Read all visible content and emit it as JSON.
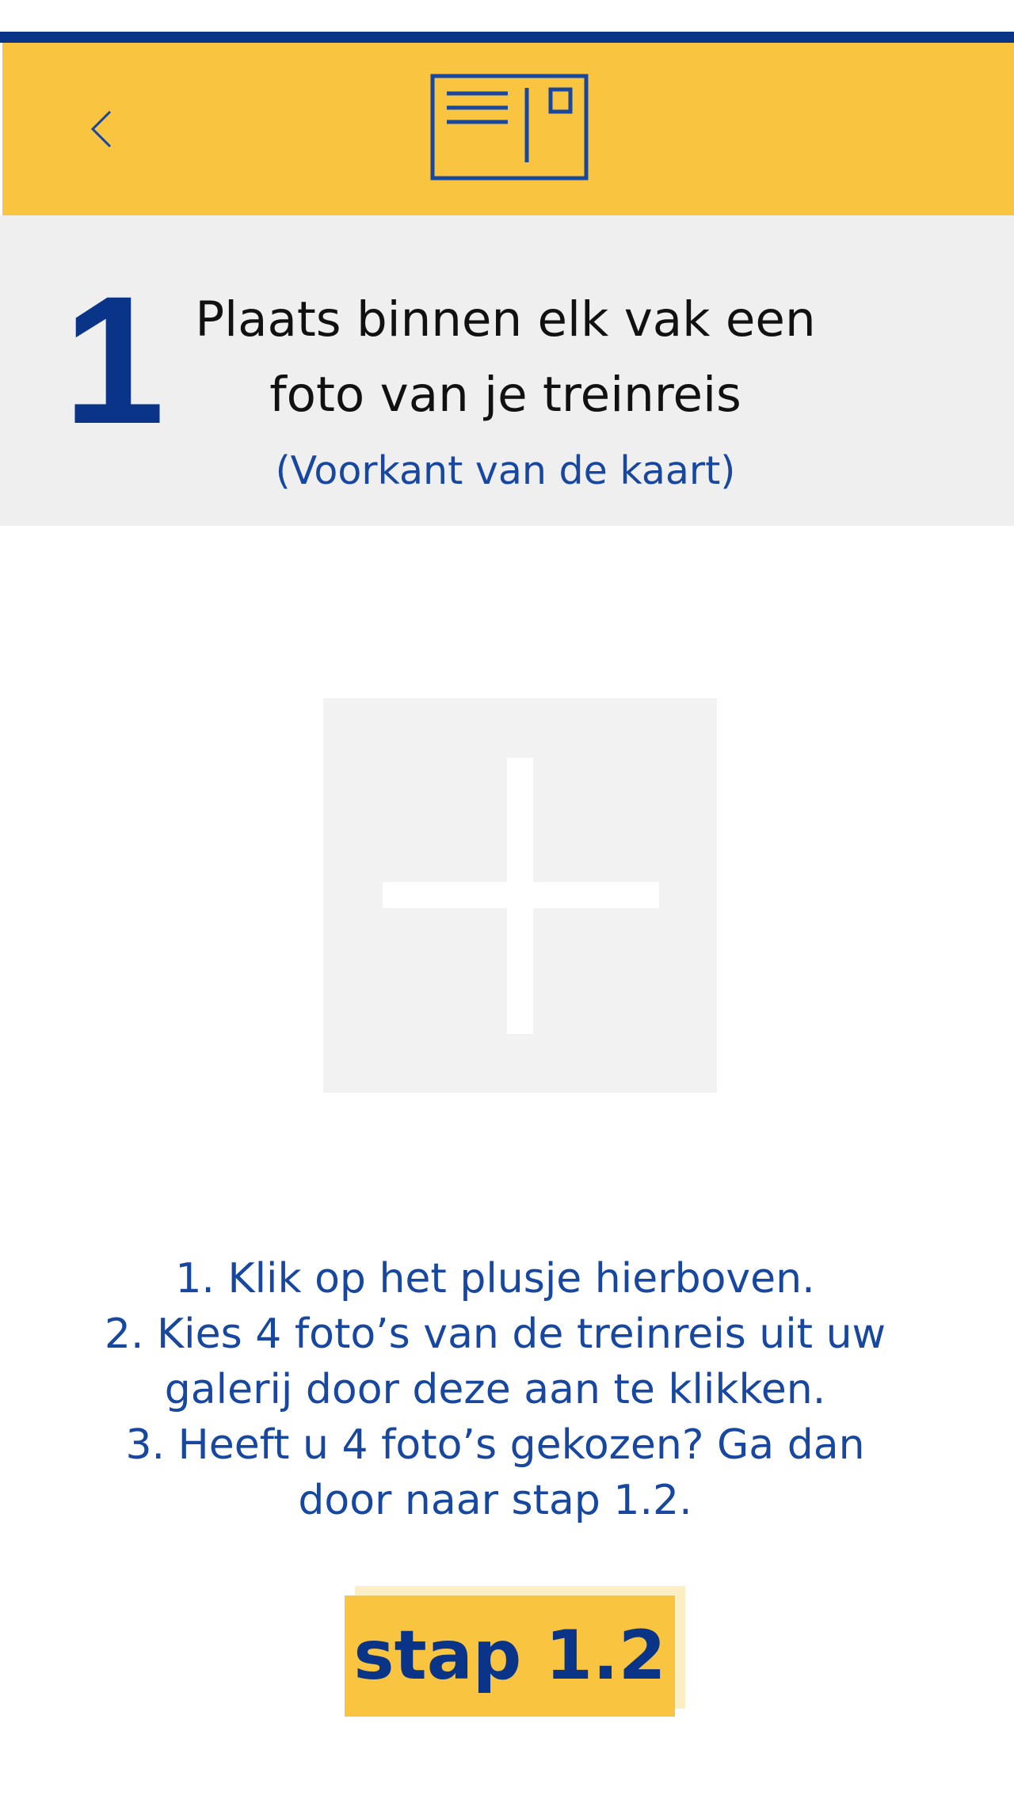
{
  "header": {
    "logo_icon": "postcard-icon",
    "back_icon": "chevron-left-icon",
    "colors": {
      "stripe": "#0a3487",
      "bar": "#f9c440",
      "icon": "#17479e"
    }
  },
  "step": {
    "number": "1",
    "title_line1": "Plaats binnen elk vak een",
    "title_line2": "foto van je treinreis",
    "subtitle": "(Voorkant van de kaart)"
  },
  "photo_slot": {
    "icon": "plus-icon"
  },
  "instructions": {
    "lines": [
      "1. Klik op het plusje hierboven.",
      "2. Kies 4 foto’s van de treinreis uit uw",
      "galerij door deze aan te klikken.",
      "3. Heeft u 4 foto’s gekozen? Ga dan",
      "door naar stap 1.2."
    ]
  },
  "next_button": {
    "label": "stap 1.2",
    "color": "#f9c440",
    "text_color": "#0a3487"
  }
}
